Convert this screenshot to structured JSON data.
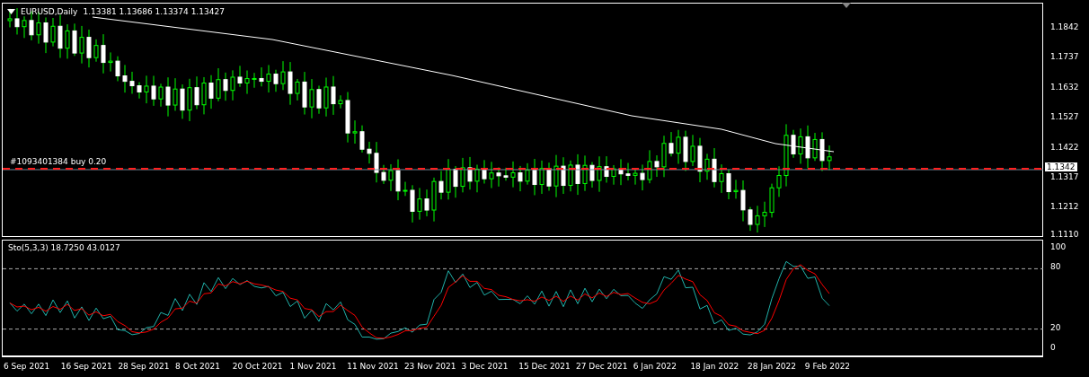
{
  "chart": {
    "symbol_label": "EURUSD,Daily",
    "ohlc": "1.13381 1.13686 1.13374 1.13427",
    "order_line": {
      "label": "#1093401384 buy 0.20"
    },
    "price_axis": [
      "1.1842",
      "1.1737",
      "1.1632",
      "1.1527",
      "1.1422",
      "1.1317",
      "1.1212",
      "1.1110"
    ],
    "current_price": "1.1342"
  },
  "indicator": {
    "label": "Sto(5,3,3) 18.7250 43.0127",
    "axis": [
      "100",
      "80",
      "20",
      "0"
    ]
  },
  "time_axis": [
    "6 Sep 2021",
    "16 Sep 2021",
    "28 Sep 2021",
    "8 Oct 2021",
    "20 Oct 2021",
    "1 Nov 2021",
    "11 Nov 2021",
    "23 Nov 2021",
    "3 Dec 2021",
    "15 Dec 2021",
    "27 Dec 2021",
    "6 Jan 2022",
    "18 Jan 2022",
    "28 Jan 2022",
    "9 Feb 2022"
  ]
}
